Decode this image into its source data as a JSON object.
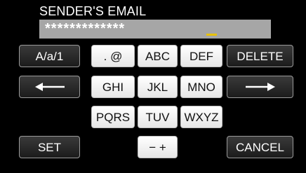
{
  "title": "SENDER'S EMAIL",
  "field": {
    "value": "*************"
  },
  "keys": {
    "mode": "A/a/1",
    "dot_at": ". @",
    "abc": "ABC",
    "def": "DEF",
    "delete": "DELETE",
    "ghi": "GHI",
    "jkl": "JKL",
    "mno": "MNO",
    "pqrs": "PQRS",
    "tuv": "TUV",
    "wxyz": "WXYZ",
    "set": "SET",
    "minus_plus": "− +",
    "cancel": "CANCEL"
  },
  "icons": {
    "left": "arrow-left-icon",
    "right": "arrow-right-icon"
  },
  "colors": {
    "background": "#000000",
    "field_bg": "#a6a6a6",
    "cursor": "#e8c200",
    "key_light": "#ffffff",
    "key_dark": "#2a2a2a"
  }
}
